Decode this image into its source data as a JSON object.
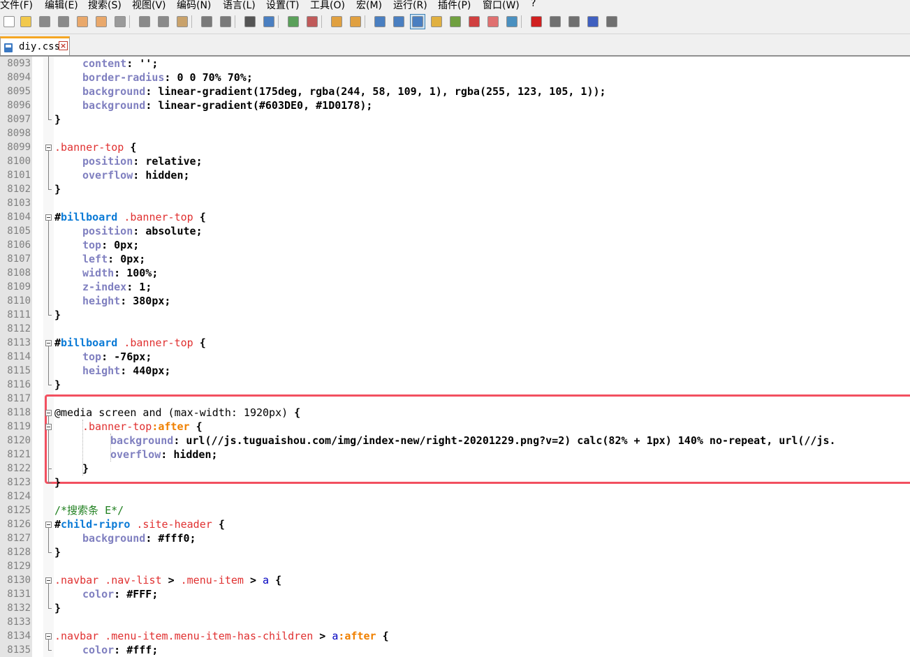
{
  "menu": [
    "文件(F)",
    "编辑(E)",
    "搜索(S)",
    "视图(V)",
    "编码(N)",
    "语言(L)",
    "设置(T)",
    "工具(O)",
    "宏(M)",
    "运行(R)",
    "插件(P)",
    "窗口(W)",
    "?"
  ],
  "toolbar": {
    "buttons": [
      {
        "name": "new-file-icon",
        "color": "#ffffff"
      },
      {
        "name": "open-file-icon",
        "color": "#f2c94c"
      },
      {
        "name": "save-icon",
        "color": "#8a8a8a"
      },
      {
        "name": "save-all-icon",
        "color": "#8a8a8a"
      },
      {
        "name": "close-icon",
        "color": "#e9a86b"
      },
      {
        "name": "close-all-icon",
        "color": "#e9a86b"
      },
      {
        "name": "print-icon",
        "color": "#9a9a9a"
      },
      {
        "name": "cut-icon",
        "color": "#8a8a8a"
      },
      {
        "name": "copy-icon",
        "color": "#8a8a8a"
      },
      {
        "name": "paste-icon",
        "color": "#c9a26b"
      },
      {
        "name": "undo-icon",
        "color": "#7a7a7a"
      },
      {
        "name": "redo-icon",
        "color": "#7a7a7a"
      },
      {
        "name": "find-icon",
        "color": "#555555"
      },
      {
        "name": "replace-icon",
        "color": "#4a7fc1"
      },
      {
        "name": "zoom-in-icon",
        "color": "#5aa05a"
      },
      {
        "name": "zoom-out-icon",
        "color": "#c05a5a"
      },
      {
        "name": "sync-vertical-icon",
        "color": "#e0a040"
      },
      {
        "name": "sync-horizontal-icon",
        "color": "#e0a040"
      },
      {
        "name": "word-wrap-icon",
        "color": "#4a7fc1"
      },
      {
        "name": "show-all-chars-icon",
        "color": "#4a7fc1"
      },
      {
        "name": "indent-guide-icon",
        "color": "#4a7fc1"
      },
      {
        "name": "user-language-icon",
        "color": "#e0b040"
      },
      {
        "name": "doc-map-icon",
        "color": "#70a040"
      },
      {
        "name": "function-list-icon",
        "color": "#d04040"
      },
      {
        "name": "folder-workspace-icon",
        "color": "#e07070"
      },
      {
        "name": "monitoring-icon",
        "color": "#4a90c0"
      },
      {
        "name": "macro-record-icon",
        "color": "#d02020"
      },
      {
        "name": "macro-stop-icon",
        "color": "#707070"
      },
      {
        "name": "macro-play-icon",
        "color": "#707070"
      },
      {
        "name": "macro-run-multiple-icon",
        "color": "#4060c0"
      },
      {
        "name": "macro-save-icon",
        "color": "#707070"
      }
    ]
  },
  "tab": {
    "label": "diy.css",
    "close": "×"
  },
  "highlight_color": "#f25060",
  "lines": [
    {
      "n": "8093",
      "indent": 1,
      "tokens": [
        [
          "prop",
          "content"
        ],
        [
          "punc",
          ": "
        ],
        [
          "val",
          "''"
        ],
        [
          "punc",
          ";"
        ]
      ]
    },
    {
      "n": "8094",
      "indent": 1,
      "tokens": [
        [
          "prop",
          "border-radius"
        ],
        [
          "punc",
          ": "
        ],
        [
          "val",
          "0 0 70% 70%"
        ],
        [
          "punc",
          ";"
        ]
      ]
    },
    {
      "n": "8095",
      "indent": 1,
      "tokens": [
        [
          "prop",
          "background"
        ],
        [
          "punc",
          ": "
        ],
        [
          "val",
          "linear-gradient(175deg, rgba(244, 58, 109, 1), rgba(255, 123, 105, 1))"
        ],
        [
          "punc",
          ";"
        ]
      ]
    },
    {
      "n": "8096",
      "indent": 1,
      "tokens": [
        [
          "prop",
          "background"
        ],
        [
          "punc",
          ": "
        ],
        [
          "val",
          "linear-gradient(#603DE0, #1D0178)"
        ],
        [
          "punc",
          ";"
        ]
      ]
    },
    {
      "n": "8097",
      "indent": 0,
      "tokens": [
        [
          "punc",
          "}"
        ]
      ]
    },
    {
      "n": "8098",
      "indent": 0,
      "tokens": []
    },
    {
      "n": "8099",
      "indent": 0,
      "tokens": [
        [
          "class",
          ".banner-top"
        ],
        [
          "plain",
          " "
        ],
        [
          "punc",
          "{"
        ]
      ]
    },
    {
      "n": "8100",
      "indent": 1,
      "tokens": [
        [
          "prop",
          "position"
        ],
        [
          "punc",
          ": "
        ],
        [
          "val",
          "relative"
        ],
        [
          "punc",
          ";"
        ]
      ]
    },
    {
      "n": "8101",
      "indent": 1,
      "tokens": [
        [
          "prop",
          "overflow"
        ],
        [
          "punc",
          ": "
        ],
        [
          "val",
          "hidden"
        ],
        [
          "punc",
          ";"
        ]
      ]
    },
    {
      "n": "8102",
      "indent": 0,
      "tokens": [
        [
          "punc",
          "}"
        ]
      ]
    },
    {
      "n": "8103",
      "indent": 0,
      "tokens": []
    },
    {
      "n": "8104",
      "indent": 0,
      "tokens": [
        [
          "hash",
          "#"
        ],
        [
          "id",
          "billboard"
        ],
        [
          "plain",
          " "
        ],
        [
          "class",
          ".banner-top"
        ],
        [
          "plain",
          " "
        ],
        [
          "punc",
          "{"
        ]
      ]
    },
    {
      "n": "8105",
      "indent": 1,
      "tokens": [
        [
          "prop",
          "position"
        ],
        [
          "punc",
          ": "
        ],
        [
          "val",
          "absolute"
        ],
        [
          "punc",
          ";"
        ]
      ]
    },
    {
      "n": "8106",
      "indent": 1,
      "tokens": [
        [
          "prop",
          "top"
        ],
        [
          "punc",
          ": "
        ],
        [
          "val",
          "0px"
        ],
        [
          "punc",
          ";"
        ]
      ]
    },
    {
      "n": "8107",
      "indent": 1,
      "tokens": [
        [
          "prop",
          "left"
        ],
        [
          "punc",
          ": "
        ],
        [
          "val",
          "0px"
        ],
        [
          "punc",
          ";"
        ]
      ]
    },
    {
      "n": "8108",
      "indent": 1,
      "tokens": [
        [
          "prop",
          "width"
        ],
        [
          "punc",
          ": "
        ],
        [
          "val",
          "100%"
        ],
        [
          "punc",
          ";"
        ]
      ]
    },
    {
      "n": "8109",
      "indent": 1,
      "tokens": [
        [
          "prop",
          "z-index"
        ],
        [
          "punc",
          ": "
        ],
        [
          "val",
          "1"
        ],
        [
          "punc",
          ";"
        ]
      ]
    },
    {
      "n": "8110",
      "indent": 1,
      "tokens": [
        [
          "prop",
          "height"
        ],
        [
          "punc",
          ": "
        ],
        [
          "val",
          "380px"
        ],
        [
          "punc",
          ";"
        ]
      ]
    },
    {
      "n": "8111",
      "indent": 0,
      "tokens": [
        [
          "punc",
          "}"
        ]
      ]
    },
    {
      "n": "8112",
      "indent": 0,
      "tokens": []
    },
    {
      "n": "8113",
      "indent": 0,
      "tokens": [
        [
          "hash",
          "#"
        ],
        [
          "id",
          "billboard"
        ],
        [
          "plain",
          " "
        ],
        [
          "class",
          ".banner-top"
        ],
        [
          "plain",
          " "
        ],
        [
          "punc",
          "{"
        ]
      ]
    },
    {
      "n": "8114",
      "indent": 1,
      "tokens": [
        [
          "prop",
          "top"
        ],
        [
          "punc",
          ": "
        ],
        [
          "val",
          "-76px"
        ],
        [
          "punc",
          ";"
        ]
      ]
    },
    {
      "n": "8115",
      "indent": 1,
      "tokens": [
        [
          "prop",
          "height"
        ],
        [
          "punc",
          ": "
        ],
        [
          "val",
          "440px"
        ],
        [
          "punc",
          ";"
        ]
      ]
    },
    {
      "n": "8116",
      "indent": 0,
      "tokens": [
        [
          "punc",
          "}"
        ]
      ]
    },
    {
      "n": "8117",
      "indent": 0,
      "tokens": []
    },
    {
      "n": "8118",
      "indent": 0,
      "tokens": [
        [
          "plain",
          "@media screen and (max-width: 1920px) "
        ],
        [
          "punc",
          "{"
        ]
      ]
    },
    {
      "n": "8119",
      "indent": 1,
      "tokens": [
        [
          "class",
          ".banner-top"
        ],
        [
          "pseudo",
          ":after"
        ],
        [
          "plain",
          " "
        ],
        [
          "punc",
          "{"
        ]
      ]
    },
    {
      "n": "8120",
      "indent": 2,
      "tokens": [
        [
          "prop",
          "background"
        ],
        [
          "punc",
          ": "
        ],
        [
          "val",
          "url(//js.tuguaishou.com/img/index-new/right-20201229.png?v=2) calc(82% + 1px) 140% no-repeat, url(//js."
        ]
      ]
    },
    {
      "n": "8121",
      "indent": 2,
      "tokens": [
        [
          "prop",
          "overflow"
        ],
        [
          "punc",
          ": "
        ],
        [
          "val",
          "hidden"
        ],
        [
          "punc",
          ";"
        ]
      ]
    },
    {
      "n": "8122",
      "indent": 1,
      "tokens": [
        [
          "punc",
          "}"
        ]
      ]
    },
    {
      "n": "8123",
      "indent": 0,
      "tokens": [
        [
          "punc",
          "}"
        ]
      ]
    },
    {
      "n": "8124",
      "indent": 0,
      "tokens": []
    },
    {
      "n": "8125",
      "indent": 0,
      "tokens": [
        [
          "comment",
          "/*搜索条 E*/"
        ]
      ]
    },
    {
      "n": "8126",
      "indent": 0,
      "tokens": [
        [
          "hash",
          "#"
        ],
        [
          "id",
          "child-ripro"
        ],
        [
          "plain",
          " "
        ],
        [
          "class",
          ".site-header"
        ],
        [
          "plain",
          " "
        ],
        [
          "punc",
          "{"
        ]
      ]
    },
    {
      "n": "8127",
      "indent": 1,
      "tokens": [
        [
          "prop",
          "background"
        ],
        [
          "punc",
          ": "
        ],
        [
          "val",
          "#fff0"
        ],
        [
          "punc",
          ";"
        ]
      ]
    },
    {
      "n": "8128",
      "indent": 0,
      "tokens": [
        [
          "punc",
          "}"
        ]
      ]
    },
    {
      "n": "8129",
      "indent": 0,
      "tokens": []
    },
    {
      "n": "8130",
      "indent": 0,
      "tokens": [
        [
          "class",
          ".navbar"
        ],
        [
          "plain",
          " "
        ],
        [
          "class",
          ".nav-list"
        ],
        [
          "plain",
          " "
        ],
        [
          "punc",
          ">"
        ],
        [
          "plain",
          " "
        ],
        [
          "class",
          ".menu-item"
        ],
        [
          "plain",
          " "
        ],
        [
          "punc",
          ">"
        ],
        [
          "plain",
          " "
        ],
        [
          "tag",
          "a"
        ],
        [
          "plain",
          " "
        ],
        [
          "punc",
          "{"
        ]
      ]
    },
    {
      "n": "8131",
      "indent": 1,
      "tokens": [
        [
          "prop",
          "color"
        ],
        [
          "punc",
          ": "
        ],
        [
          "val",
          "#FFF"
        ],
        [
          "punc",
          ";"
        ]
      ]
    },
    {
      "n": "8132",
      "indent": 0,
      "tokens": [
        [
          "punc",
          "}"
        ]
      ]
    },
    {
      "n": "8133",
      "indent": 0,
      "tokens": []
    },
    {
      "n": "8134",
      "indent": 0,
      "tokens": [
        [
          "class",
          ".navbar"
        ],
        [
          "plain",
          " "
        ],
        [
          "class",
          ".menu-item.menu-item-has-children"
        ],
        [
          "plain",
          " "
        ],
        [
          "punc",
          ">"
        ],
        [
          "plain",
          " "
        ],
        [
          "tag",
          "a"
        ],
        [
          "pseudo",
          ":after"
        ],
        [
          "plain",
          " "
        ],
        [
          "punc",
          "{"
        ]
      ]
    },
    {
      "n": "8135",
      "indent": 1,
      "tokens": [
        [
          "prop",
          "color"
        ],
        [
          "punc",
          ": "
        ],
        [
          "val",
          "#fff"
        ],
        [
          "punc",
          ";"
        ]
      ]
    }
  ]
}
